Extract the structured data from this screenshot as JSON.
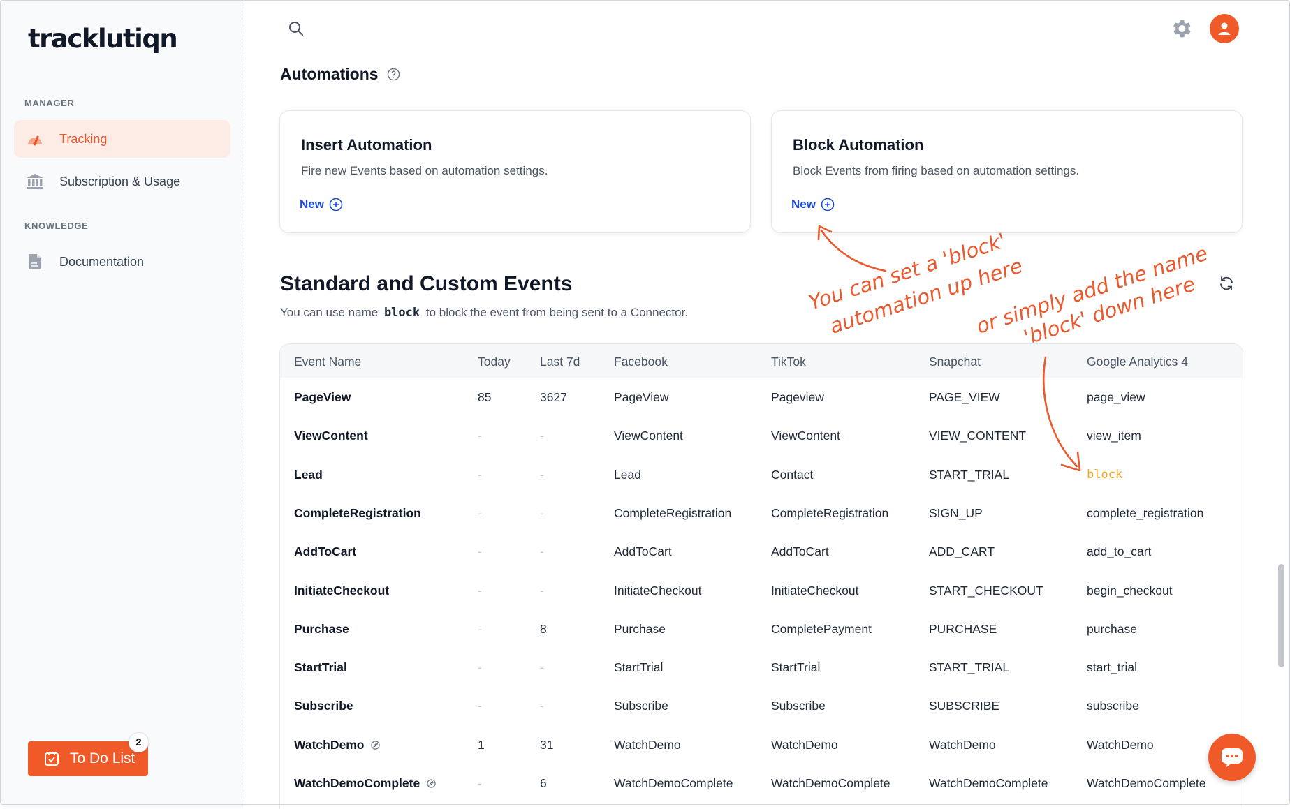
{
  "app": {
    "logo": "tracklutiqn"
  },
  "colors": {
    "accent": "#f05a28",
    "link": "#1d4ed8",
    "block": "#f5a623"
  },
  "sidebar": {
    "manager_label": "MANAGER",
    "knowledge_label": "KNOWLEDGE",
    "items": [
      {
        "label": "Tracking",
        "icon": "tracking-gauge-icon",
        "active": true
      },
      {
        "label": "Subscription & Usage",
        "icon": "bank-icon",
        "active": false
      },
      {
        "label": "Documentation",
        "icon": "document-icon",
        "active": false
      }
    ],
    "todo": {
      "label": "To Do List",
      "count": "2"
    }
  },
  "automations": {
    "heading": "Automations",
    "cards": [
      {
        "title": "Insert Automation",
        "description": "Fire new Events based on automation settings.",
        "action": "New"
      },
      {
        "title": "Block Automation",
        "description": "Block Events from firing based on automation settings.",
        "action": "New"
      }
    ]
  },
  "events": {
    "heading": "Standard and Custom Events",
    "sub_prefix": "You can use name",
    "sub_code": "block",
    "sub_suffix": "to block the event from being sent to a Connector.",
    "columns": [
      "Event Name",
      "Today",
      "Last 7d",
      "Facebook",
      "TikTok",
      "Snapchat",
      "Google Analytics 4"
    ],
    "rows": [
      {
        "name": "PageView",
        "today": "85",
        "last7": "3627",
        "facebook": "PageView",
        "tiktok": "Pageview",
        "snapchat": "PAGE_VIEW",
        "ga4": "page_view",
        "editable": false
      },
      {
        "name": "ViewContent",
        "today": "-",
        "last7": "-",
        "facebook": "ViewContent",
        "tiktok": "ViewContent",
        "snapchat": "VIEW_CONTENT",
        "ga4": "view_item",
        "editable": false
      },
      {
        "name": "Lead",
        "today": "-",
        "last7": "-",
        "facebook": "Lead",
        "tiktok": "Contact",
        "snapchat": "START_TRIAL",
        "ga4": "block",
        "editable": false
      },
      {
        "name": "CompleteRegistration",
        "today": "-",
        "last7": "-",
        "facebook": "CompleteRegistration",
        "tiktok": "CompleteRegistration",
        "snapchat": "SIGN_UP",
        "ga4": "complete_registration",
        "editable": false
      },
      {
        "name": "AddToCart",
        "today": "-",
        "last7": "-",
        "facebook": "AddToCart",
        "tiktok": "AddToCart",
        "snapchat": "ADD_CART",
        "ga4": "add_to_cart",
        "editable": false
      },
      {
        "name": "InitiateCheckout",
        "today": "-",
        "last7": "-",
        "facebook": "InitiateCheckout",
        "tiktok": "InitiateCheckout",
        "snapchat": "START_CHECKOUT",
        "ga4": "begin_checkout",
        "editable": false
      },
      {
        "name": "Purchase",
        "today": "-",
        "last7": "8",
        "facebook": "Purchase",
        "tiktok": "CompletePayment",
        "snapchat": "PURCHASE",
        "ga4": "purchase",
        "editable": false
      },
      {
        "name": "StartTrial",
        "today": "-",
        "last7": "-",
        "facebook": "StartTrial",
        "tiktok": "StartTrial",
        "snapchat": "START_TRIAL",
        "ga4": "start_trial",
        "editable": false
      },
      {
        "name": "Subscribe",
        "today": "-",
        "last7": "-",
        "facebook": "Subscribe",
        "tiktok": "Subscribe",
        "snapchat": "SUBSCRIBE",
        "ga4": "subscribe",
        "editable": false
      },
      {
        "name": "WatchDemo",
        "today": "1",
        "last7": "31",
        "facebook": "WatchDemo",
        "tiktok": "WatchDemo",
        "snapchat": "WatchDemo",
        "ga4": "WatchDemo",
        "editable": true
      },
      {
        "name": "WatchDemoComplete",
        "today": "-",
        "last7": "6",
        "facebook": "WatchDemoComplete",
        "tiktok": "WatchDemoComplete",
        "snapchat": "WatchDemoComplete",
        "ga4": "WatchDemoComplete",
        "editable": true
      }
    ]
  },
  "annotations": {
    "note1_line1": "You can set a 'block'",
    "note1_line2": "automation up here",
    "note2_line1": "or simply add the name",
    "note2_line2": "'block' down here"
  }
}
